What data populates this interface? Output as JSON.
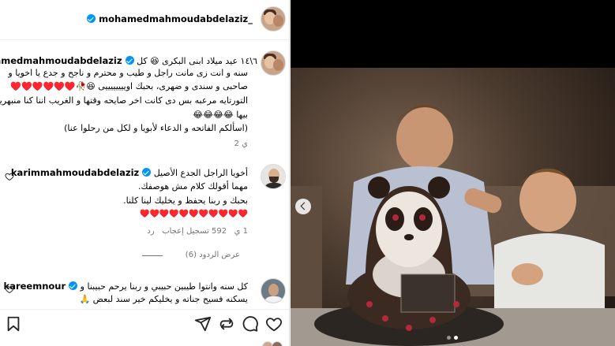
{
  "header": {
    "username": "mohamedmahmoudabdelaziz_"
  },
  "caption": {
    "username": "mohamedmahmoudabdelaziz_",
    "lines": [
      "٦\\١٤ عيد ميلاد ابنى البكرى 😆 كل",
      "سنه و انت زى مانت راجل و طيب و محترم و ناجح و جدع يا اخويا و",
      "صاحبى و سندى و ضهرى، بحبك اوييييييييى 😆🥀♥️♥️♥️♥️♥️♥️",
      "التورتايه مرعبه بس دى كانت اخر صايحه وقتها و الغريب اننا كنا منبهرين",
      "بيها 😂😂😂😂",
      "(اسألكم الفاتحه و الدعاء لأبويا و لكل من رحلوا عنا)"
    ],
    "time": "2 ي"
  },
  "comments": [
    {
      "username": "karimmahmoudabdelaziz",
      "lines": [
        "أخويا الراجل الجدع الأصيل",
        "مهما أقولك كلام مش هوصفك.",
        "بحبك و ربنا يحفظ و يخليك لينا كلنا.",
        "♥️♥️♥️♥️♥️♥️♥️♥️♥️♥️♥️"
      ],
      "time": "1 ي",
      "likes": "592 تسجيل إعجاب",
      "reply": "رد",
      "view_replies": "عرض الردود (6)"
    },
    {
      "username": "kareemnour",
      "lines": [
        "كل سنه وانتوا طيبين حبيبي و ربنا يرحم حبيبنا و",
        "يسكنه فسيح جناته و يخليكم خير سند لبعض 🙏"
      ]
    }
  ],
  "icons": {
    "like": "heart-icon",
    "comment": "comment-icon",
    "share": "share-icon",
    "repost": "repost-icon",
    "save": "bookmark-icon"
  },
  "colors": {
    "verified": "#0095f6",
    "secondary_text": "#737373",
    "border": "#dbdbdb"
  }
}
